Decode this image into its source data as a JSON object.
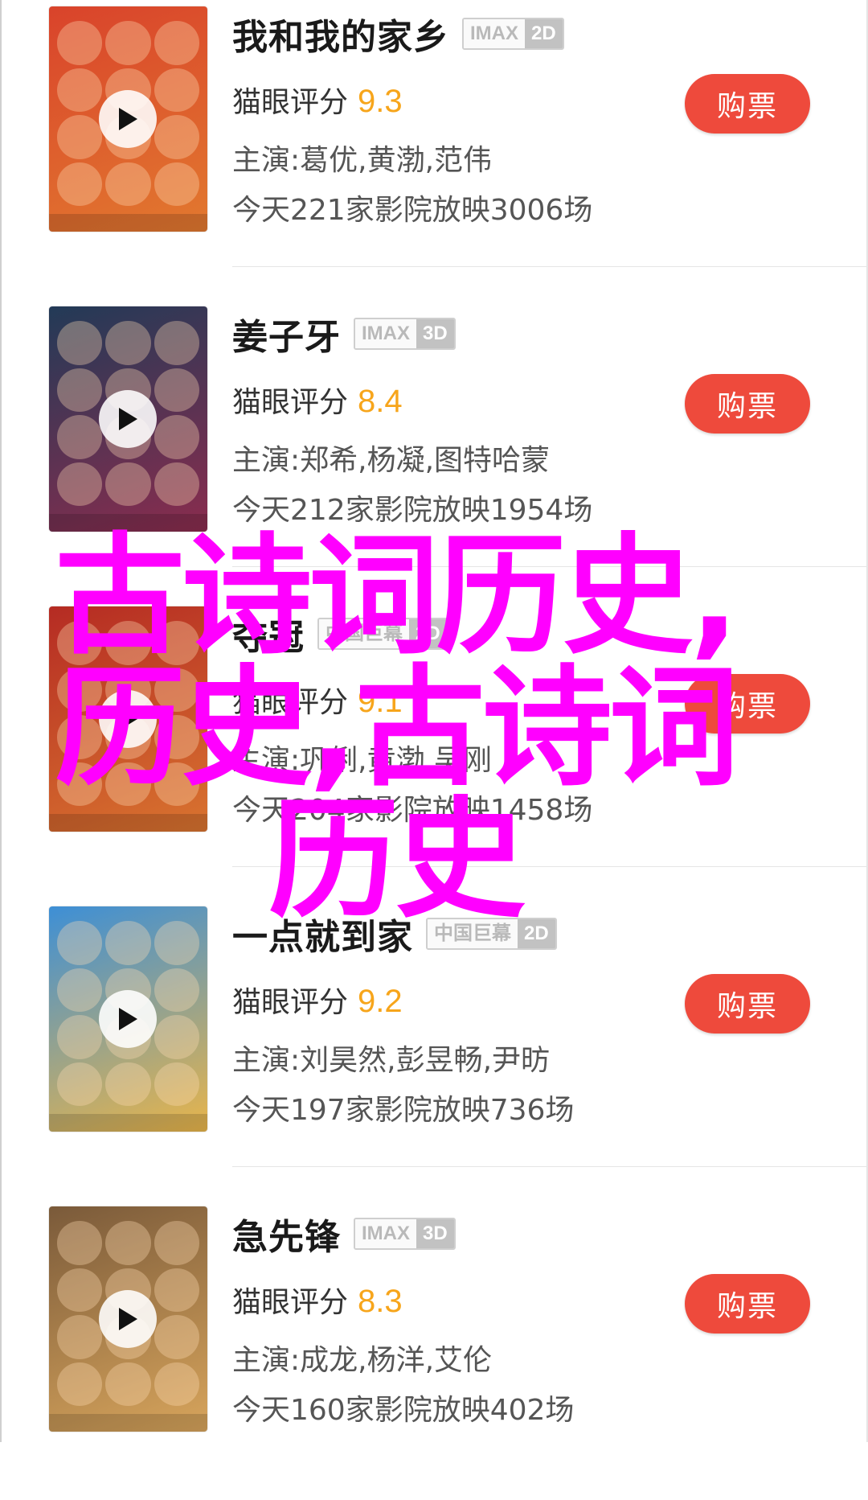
{
  "movies": [
    {
      "title": "我和我的家乡",
      "badge": [
        "IMAX",
        "2D"
      ],
      "rating_label": "猫眼评分",
      "score": "9.3",
      "cast": "主演:葛优,黄渤,范伟",
      "showing": "今天221家影院放映3006场",
      "button": "购票",
      "poster_colors": [
        "#d9432b",
        "#e2792f"
      ]
    },
    {
      "title": "姜子牙",
      "badge": [
        "IMAX",
        "3D"
      ],
      "rating_label": "猫眼评分",
      "score": "8.4",
      "cast": "主演:郑希,杨凝,图特哈蒙",
      "showing": "今天212家影院放映1954场",
      "button": "购票",
      "poster_colors": [
        "#223a57",
        "#8b2c4e"
      ]
    },
    {
      "title": "夺冠",
      "badge": [
        "中国巨幕",
        "2D"
      ],
      "rating_label": "猫眼评分",
      "score": "9.1",
      "cast": "主演:巩俐,黄渤,吴刚",
      "showing": "今天204家影院放映1458场",
      "button": "购票",
      "poster_colors": [
        "#b52b23",
        "#d9742f"
      ]
    },
    {
      "title": "一点就到家",
      "badge": [
        "中国巨幕",
        "2D"
      ],
      "rating_label": "猫眼评分",
      "score": "9.2",
      "cast": "主演:刘昊然,彭昱畅,尹昉",
      "showing": "今天197家影院放映736场",
      "button": "购票",
      "poster_colors": [
        "#3d8fd6",
        "#e9b54a"
      ]
    },
    {
      "title": "急先锋",
      "badge": [
        "IMAX",
        "3D"
      ],
      "rating_label": "猫眼评分",
      "score": "8.3",
      "cast": "主演:成龙,杨洋,艾伦",
      "showing": "今天160家影院放映402场",
      "button": "购票",
      "poster_colors": [
        "#7a5a3a",
        "#d8a55c"
      ]
    }
  ],
  "watermark": {
    "line1": "古诗词历史,",
    "line2": "历史,古诗词",
    "line3": "历史"
  },
  "colors": {
    "score": "#f7a51b",
    "button": "#ee4a3c",
    "watermark": "#ff00ff"
  }
}
